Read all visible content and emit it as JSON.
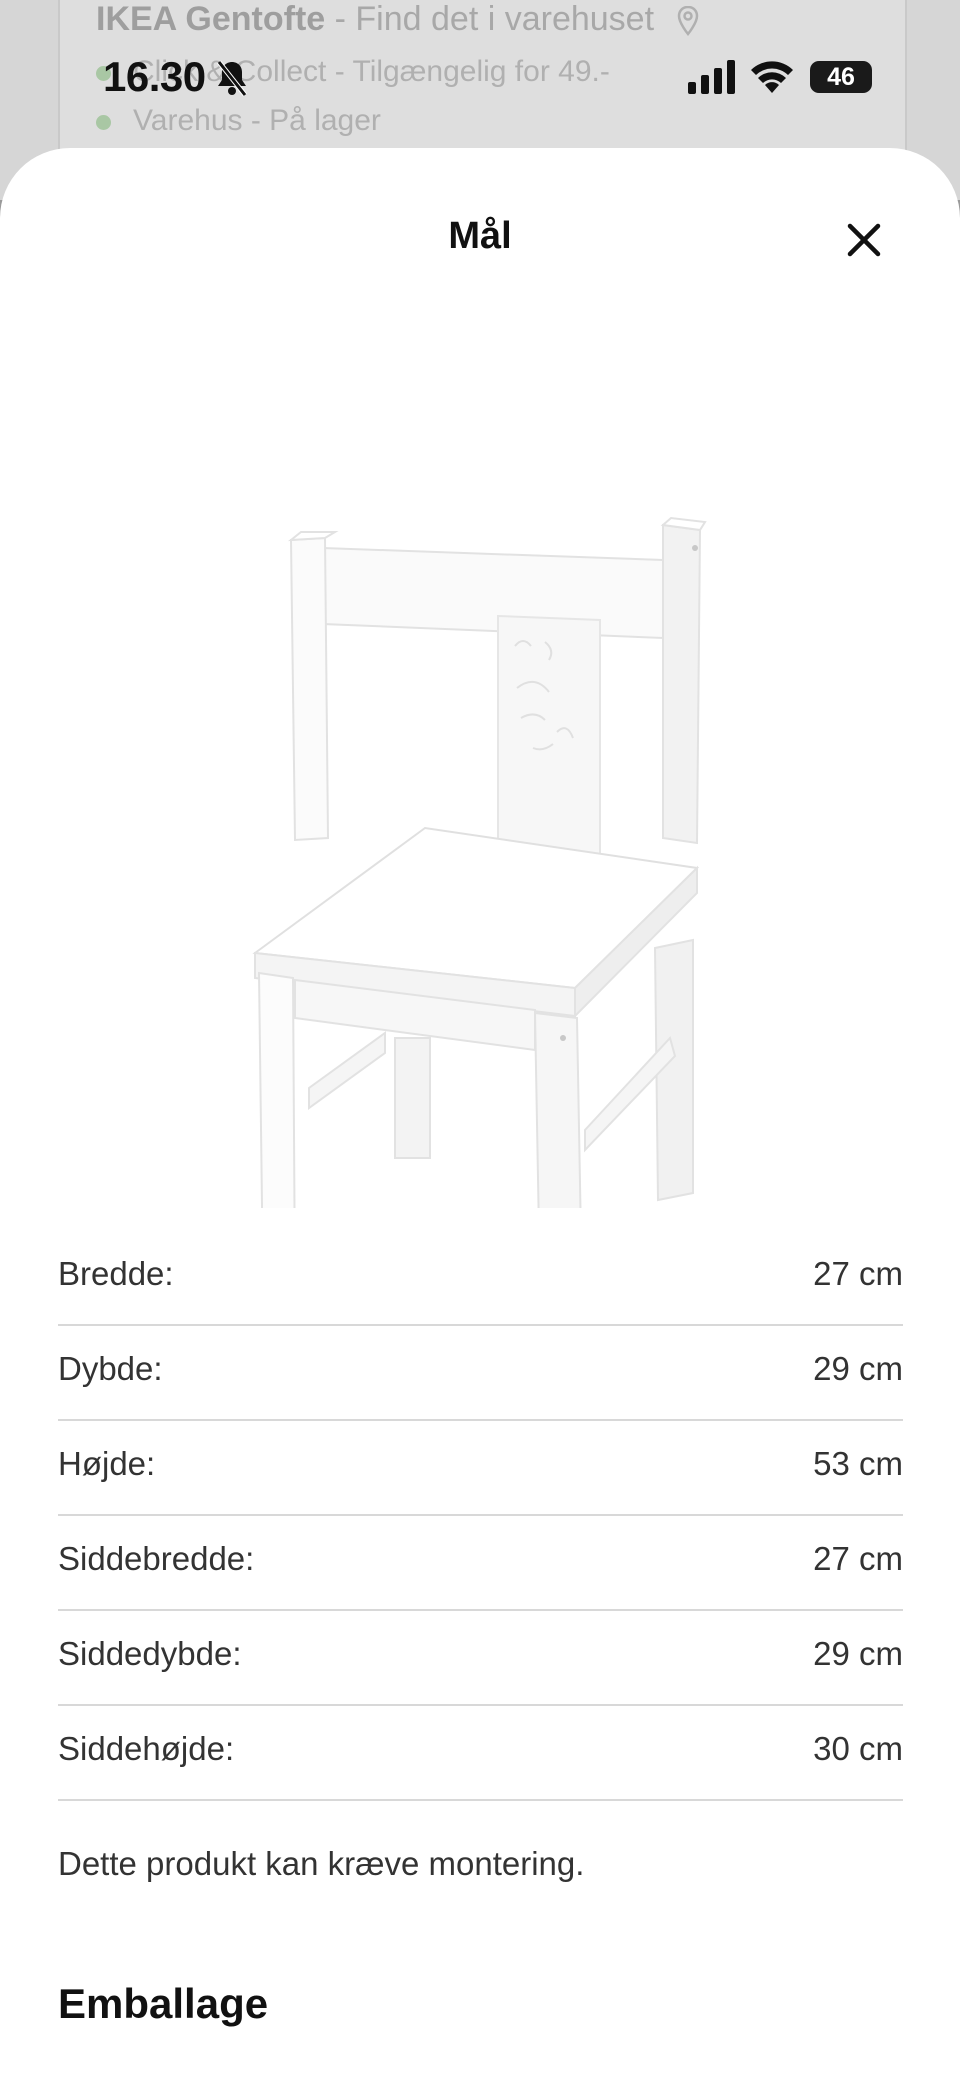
{
  "background": {
    "store_name": "IKEA Gentofte",
    "store_action": "- Find det i varehuset",
    "line1": "Click & Collect - Tilgængelig for 49.-",
    "line2": "Varehus - På lager"
  },
  "status_bar": {
    "time": "16.30",
    "battery": "46"
  },
  "sheet": {
    "title": "Mål",
    "close_label": "Luk"
  },
  "dimensions": [
    {
      "label": "Bredde:",
      "value": "27 cm"
    },
    {
      "label": "Dybde:",
      "value": "29 cm"
    },
    {
      "label": "Højde:",
      "value": "53 cm"
    },
    {
      "label": "Siddebredde:",
      "value": "27 cm"
    },
    {
      "label": "Siddedybde:",
      "value": "29 cm"
    },
    {
      "label": "Siddehøjde:",
      "value": "30 cm"
    }
  ],
  "assembly_note": "Dette produkt kan kræve montering.",
  "packaging_heading": "Emballage",
  "colors": {
    "overlay": "#9a9a9a",
    "sheet": "#ffffff",
    "divider": "#d8d8d8",
    "stock_dot": "#a9c7a4"
  },
  "icons": [
    "bell-muted-icon",
    "signal-icon",
    "wifi-icon",
    "battery-icon",
    "close-icon",
    "location-pin-icon",
    "chevron-right-icon"
  ]
}
